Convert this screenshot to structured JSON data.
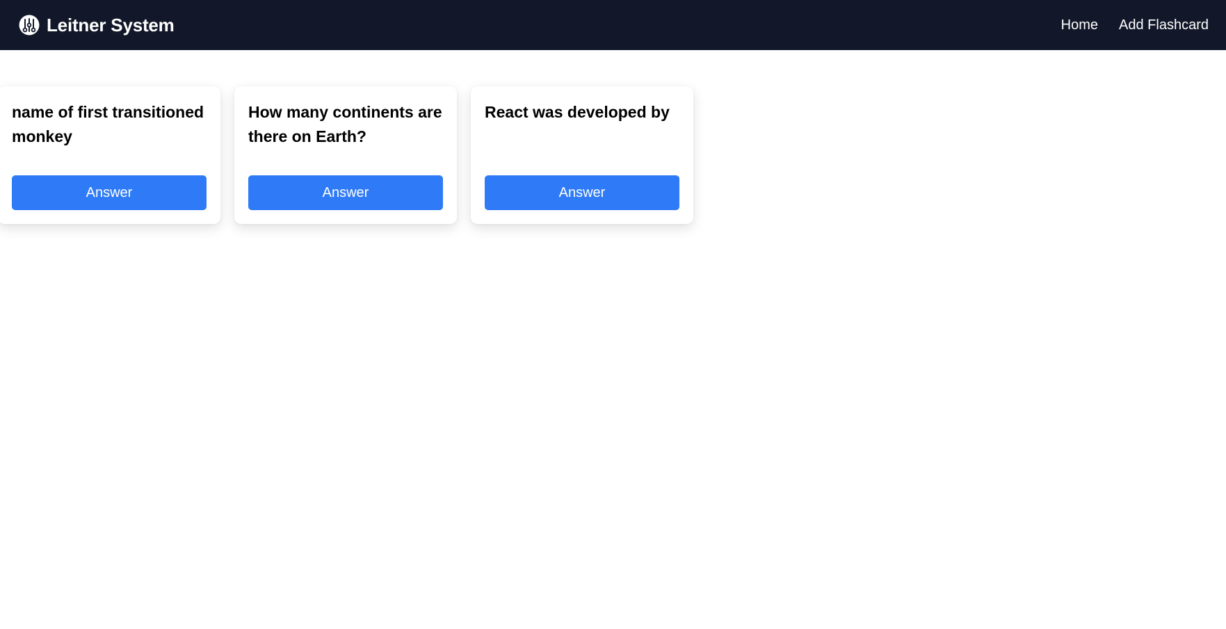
{
  "navbar": {
    "brand_icon": "brain-circuit-icon",
    "brand_title": "Leitner System",
    "links": [
      {
        "label": "Home"
      },
      {
        "label": "Add Flashcard"
      }
    ]
  },
  "cards": [
    {
      "question": "name of first transitioned monkey",
      "button_label": "Answer"
    },
    {
      "question": "How many continents are there on Earth?",
      "button_label": "Answer"
    },
    {
      "question": "React was developed by",
      "button_label": "Answer"
    }
  ],
  "colors": {
    "navbar_bg": "#121829",
    "button_bg": "#2f7bf7",
    "page_bg": "#ffffff"
  }
}
